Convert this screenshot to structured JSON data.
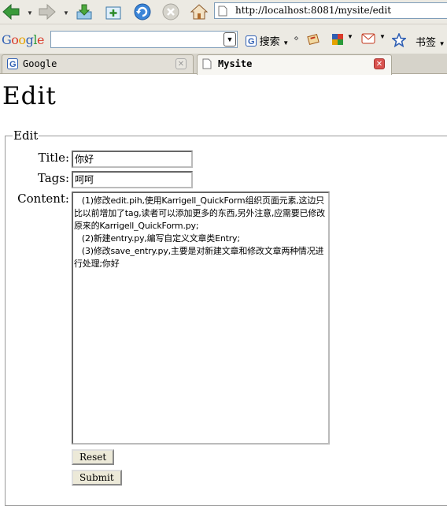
{
  "browser": {
    "url": "http://localhost:8081/mysite/edit",
    "google_toolbar": {
      "logo_text": "Google",
      "search_value": "",
      "search_button_label": "搜索",
      "bookmarks_label": "书签"
    },
    "tabs": [
      {
        "label": "Google",
        "active": false
      },
      {
        "label": "Mysite",
        "active": true
      }
    ]
  },
  "page": {
    "title": "Edit",
    "form": {
      "legend": "Edit",
      "title_label": "Title:",
      "title_value": "你好",
      "tags_label": "Tags:",
      "tags_value": "呵呵",
      "content_label": "Content:",
      "content_value": "   (1)修改edit.pih,使用Karrigell_QuickForm组织页面元素,这边只比以前增加了tag,读者可以添加更多的东西,另外注意,应需要已修改原来的Karrigell_QuickForm.py;\n   (2)新建entry.py,编写自定义文章类Entry;\n   (3)修改save_entry.py,主要是对新建文章和修改文章两种情况进行处理;你好",
      "reset_label": "Reset",
      "submit_label": "Submit"
    }
  },
  "colors": {
    "accent": "#2f5fb3",
    "nav_arrow_green": "#3a9b3a",
    "tab_close_red": "#d9534f"
  },
  "icons": [
    "back-arrow-icon",
    "forward-arrow-icon",
    "download-icon",
    "new-tab-icon",
    "reload-icon",
    "stop-icon",
    "home-icon",
    "page-icon",
    "google-g-icon",
    "search-options-icon",
    "news-icon",
    "puzzle-icon",
    "mail-icon",
    "star-icon",
    "close-icon"
  ]
}
